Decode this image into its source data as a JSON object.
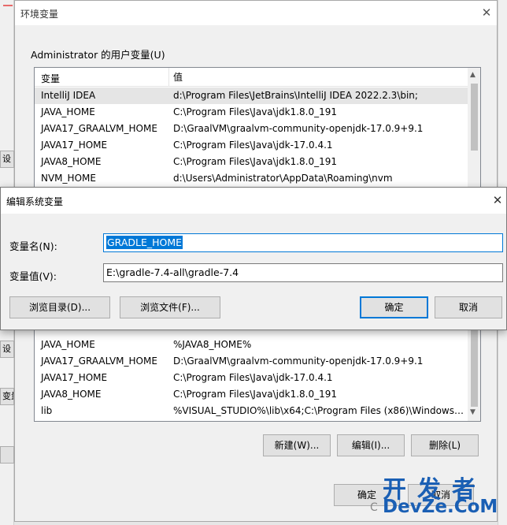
{
  "background_window": {
    "left_buttons": [
      "设",
      "设",
      "变量"
    ]
  },
  "env_window": {
    "title": "环境变量",
    "close_glyph": "✕",
    "user_vars_label": "Administrator 的用户变量(U)",
    "columns": {
      "name": "变量",
      "value": "值"
    },
    "user_vars": [
      {
        "name": "IntelliJ IDEA",
        "value": "d:\\Program Files\\JetBrains\\IntelliJ IDEA 2022.2.3\\bin;"
      },
      {
        "name": "JAVA_HOME",
        "value": "C:\\Program Files\\Java\\jdk1.8.0_191"
      },
      {
        "name": "JAVA17_GRAALVM_HOME",
        "value": "D:\\GraalVM\\graalvm-community-openjdk-17.0.9+9.1"
      },
      {
        "name": "JAVA17_HOME",
        "value": "C:\\Program Files\\Java\\jdk-17.0.4.1"
      },
      {
        "name": "JAVA8_HOME",
        "value": "C:\\Program Files\\Java\\jdk1.8.0_191"
      },
      {
        "name": "NVM_HOME",
        "value": "d:\\Users\\Administrator\\AppData\\Roaming\\nvm"
      }
    ],
    "system_vars": [
      {
        "name": "JAVA_HOME",
        "value": "%JAVA8_HOME%"
      },
      {
        "name": "JAVA17_GRAALVM_HOME",
        "value": "D:\\GraalVM\\graalvm-community-openjdk-17.0.9+9.1"
      },
      {
        "name": "JAVA17_HOME",
        "value": "C:\\Program Files\\Java\\jdk-17.0.4.1"
      },
      {
        "name": "JAVA8_HOME",
        "value": "C:\\Program Files\\Java\\jdk1.8.0_191"
      },
      {
        "name": "lib",
        "value": "%VISUAL_STUDIO%\\lib\\x64;C:\\Program Files (x86)\\Windows ..."
      }
    ],
    "system_buttons": {
      "new": "新建(W)...",
      "edit": "编辑(I)...",
      "delete": "删除(L)"
    },
    "ok_label": "确定",
    "cancel_label": "取消"
  },
  "edit_dialog": {
    "title": "编辑系统变量",
    "close_glyph": "✕",
    "name_label": "变量名(N):",
    "name_value": "GRADLE_HOME",
    "value_label": "变量值(V):",
    "value_value": "E:\\gradle-7.4-all\\gradle-7.4",
    "browse_dir": "浏览目录(D)...",
    "browse_file": "浏览文件(F)...",
    "ok": "确定",
    "cancel": "取消"
  },
  "watermark": {
    "line1": "开发者",
    "line2": "DevZe.CoM",
    "prefix": "C"
  }
}
